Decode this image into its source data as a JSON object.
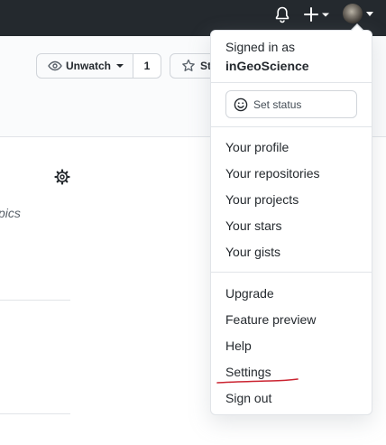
{
  "header": {
    "notifications_icon": "bell-icon",
    "create_icon": "plus-icon",
    "avatar_icon": "user-avatar"
  },
  "repo_actions": {
    "watch_label": "Unwatch",
    "watch_count": "1",
    "star_label": "Star"
  },
  "about": {
    "topics_fragment": "pics"
  },
  "user_menu": {
    "signed_in_label": "Signed in as",
    "username": "inGeoScience",
    "set_status_label": "Set status",
    "items": [
      {
        "label": "Your profile"
      },
      {
        "label": "Your repositories"
      },
      {
        "label": "Your projects"
      },
      {
        "label": "Your stars"
      },
      {
        "label": "Your gists"
      },
      {
        "label": "Upgrade"
      },
      {
        "label": "Feature preview"
      },
      {
        "label": "Help"
      },
      {
        "label": "Settings"
      },
      {
        "label": "Sign out"
      }
    ]
  },
  "colors": {
    "header_bg": "#24292e",
    "annotation_red": "#cb2431"
  }
}
